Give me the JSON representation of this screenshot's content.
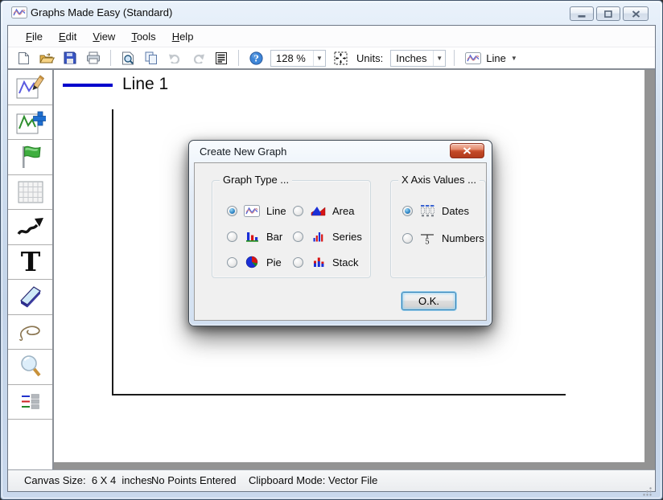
{
  "window": {
    "title": "Graphs Made Easy (Standard)",
    "buttons": [
      "minimize",
      "maximize",
      "close"
    ]
  },
  "menu": {
    "items": [
      {
        "label": "File"
      },
      {
        "label": "Edit"
      },
      {
        "label": "View"
      },
      {
        "label": "Tools"
      },
      {
        "label": "Help"
      }
    ]
  },
  "toolbar": {
    "zoom_value": "128 %",
    "units_label": "Units:",
    "units_value": "Inches",
    "chart_type_value": "Line",
    "icons": [
      "new-document",
      "open",
      "save",
      "print",
      "print-preview",
      "copy",
      "undo",
      "redo",
      "data-list",
      "help",
      "fit-page",
      "line-chart"
    ]
  },
  "palette": {
    "tools": [
      "edit-graph",
      "add-graph",
      "flag",
      "grid",
      "trend-arrow",
      "text",
      "eraser",
      "lasso",
      "zoom",
      "legend"
    ]
  },
  "canvas": {
    "legend_label": "Line 1"
  },
  "dialog": {
    "title": "Create New Graph",
    "graph_type": {
      "label": "Graph Type ...",
      "options": [
        {
          "label": "Line",
          "icon": "line-chart-icon",
          "selected": true
        },
        {
          "label": "Area",
          "icon": "area-chart-icon",
          "selected": false
        },
        {
          "label": "Bar",
          "icon": "bar-chart-icon",
          "selected": false
        },
        {
          "label": "Series",
          "icon": "series-chart-icon",
          "selected": false
        },
        {
          "label": "Pie",
          "icon": "pie-chart-icon",
          "selected": false
        },
        {
          "label": "Stack",
          "icon": "stack-chart-icon",
          "selected": false
        }
      ]
    },
    "x_axis": {
      "label": "X Axis Values ...",
      "options": [
        {
          "label": "Dates",
          "icon": "calendar-icon",
          "selected": true
        },
        {
          "label": "Numbers",
          "icon": "number-axis-icon",
          "selected": false
        }
      ]
    },
    "ok_label": "O.K."
  },
  "statusbar": {
    "canvas_size": "Canvas Size:  6 X 4  inches",
    "points": "No Points Entered",
    "clipboard": "Clipboard Mode: Vector File"
  }
}
